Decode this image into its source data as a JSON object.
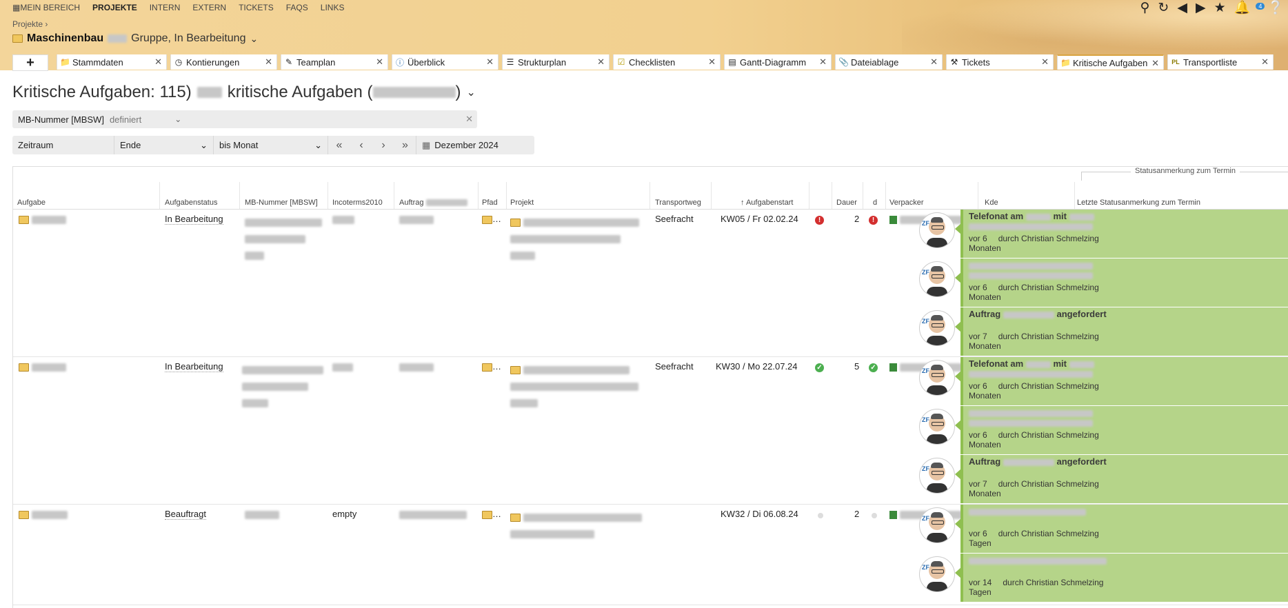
{
  "topnav": [
    "MEIN BEREICH",
    "PROJEKTE",
    "INTERN",
    "EXTERN",
    "TICKETS",
    "FAQS",
    "LINKS"
  ],
  "topnav_active": "PROJEKTE",
  "notification_count": "4",
  "breadcrumb": "Projekte ›",
  "project": {
    "name_bold": "Maschinenbau",
    "name_rest": "Gruppe, In Bearbeitung"
  },
  "tabs": [
    "Stammdaten",
    "Kontierungen",
    "Teamplan",
    "Überblick",
    "Strukturplan",
    "Checklisten",
    "Gantt-Diagramm",
    "Dateiablage",
    "Tickets",
    "Kritische Aufgaben",
    "Transportliste"
  ],
  "active_tab": "Kritische Aufgaben",
  "heading": {
    "prefix": "Kritische Aufgaben: 115)",
    "middle": "kritische Aufgaben (",
    "suffix": ")"
  },
  "filter1": {
    "label": "MB-Nummer [MBSW]",
    "value": "definiert"
  },
  "filter2": {
    "zeitraum": "Zeitraum",
    "ende": "Ende",
    "bis": "bis Monat",
    "month": "Dezember 2024"
  },
  "columns": {
    "group": "Statusanmerkung zum Termin",
    "aufgabe": "Aufgabe",
    "status": "Aufgabenstatus",
    "mb": "MB-Nummer [MBSW]",
    "incoterms": "Incoterms2010",
    "auftrag": "Auftrag",
    "pfad": "Pfad",
    "projekt": "Projekt",
    "transport": "Transportweg",
    "start": "Aufgabenstart",
    "dauer": "Dauer",
    "d": "d",
    "verpacker": "Verpacker",
    "kde": "Kde",
    "letzte": "Letzte Statusanmerkung zum Termin"
  },
  "rows": [
    {
      "status": "In Bearbeitung",
      "incoterms": "",
      "transport": "Seefracht",
      "start": "KW05 / Fr 02.02.24",
      "dauer": "2",
      "flag": "red",
      "kde": "",
      "notes": [
        {
          "title": "Telefonat am",
          "title_mid": "mit",
          "age": "vor 6",
          "unit": "Monaten",
          "by": "durch Christian Schmelzing"
        },
        {
          "title": "",
          "title_mid": "",
          "age": "vor 6",
          "unit": "Monaten",
          "by": "durch Christian Schmelzing"
        },
        {
          "title": "Auftrag",
          "title_mid": "angefordert",
          "age": "vor 7",
          "unit": "Monaten",
          "by": "durch Christian Schmelzing"
        }
      ]
    },
    {
      "status": "In Bearbeitung",
      "incoterms": "",
      "transport": "Seefracht",
      "start": "KW30 / Mo 22.07.24",
      "dauer": "5",
      "flag": "green",
      "kde": "",
      "notes": [
        {
          "title": "Telefonat am",
          "title_mid": "mit",
          "age": "vor 6",
          "unit": "Monaten",
          "by": "durch Christian Schmelzing"
        },
        {
          "title": "",
          "title_mid": "",
          "age": "vor 6",
          "unit": "Monaten",
          "by": "durch Christian Schmelzing"
        },
        {
          "title": "Auftrag",
          "title_mid": "angefordert",
          "age": "vor 7",
          "unit": "Monaten",
          "by": "durch Christian Schmelzing"
        }
      ]
    },
    {
      "status": "Beauftragt",
      "incoterms": "empty",
      "transport": "",
      "start": "KW32 / Di 06.08.24",
      "dauer": "2",
      "flag": "grey",
      "kde": "ZF",
      "notes": [
        {
          "title": "",
          "title_mid": "",
          "age": "vor 6",
          "unit": "Tagen",
          "by": "durch Christian Schmelzing"
        },
        {
          "title": "",
          "title_mid": "",
          "age": "vor 14",
          "unit": "Tagen",
          "by": "durch Christian Schmelzing"
        }
      ]
    }
  ]
}
